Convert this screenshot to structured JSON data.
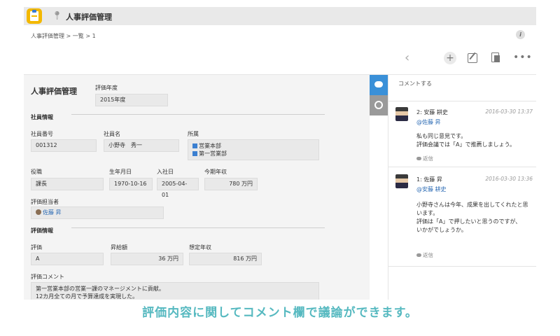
{
  "app": {
    "title": "人事評価管理"
  },
  "breadcrumb": "人事評価管理 > 一覧 > 1",
  "record": {
    "title": "人事評価管理",
    "fiscal_year": {
      "label": "評価年度",
      "value": "2015年度"
    },
    "employee_section": "社員情報",
    "employee_no": {
      "label": "社員番号",
      "value": "001312"
    },
    "employee_name": {
      "label": "社員名",
      "value": "小野寺　秀一"
    },
    "department": {
      "label": "所属",
      "values": [
        "営業本部",
        "第一営業部"
      ]
    },
    "position": {
      "label": "役職",
      "value": "課長"
    },
    "birth_date": {
      "label": "生年月日",
      "value": "1970-10-16"
    },
    "hire_date": {
      "label": "入社日",
      "value": "2005-04-01"
    },
    "current_salary": {
      "label": "今期年収",
      "value": "780 万円"
    },
    "evaluator": {
      "label": "評価担当者",
      "value": "佐藤 昇"
    },
    "eval_section": "評価情報",
    "rating": {
      "label": "評価",
      "value": "A"
    },
    "raise": {
      "label": "昇給額",
      "value": "36 万円"
    },
    "expected_salary": {
      "label": "想定年収",
      "value": "816 万円"
    },
    "comment": {
      "label": "評価コメント",
      "lines": [
        "第一営業本部の営業一課のマネージメントに貢献。",
        "12カ月全ての月で予算達成を実現した。"
      ]
    }
  },
  "panel": {
    "comment_placeholder": "コメントする",
    "comments": [
      {
        "author": "2: 安藤 耕史",
        "time": "2016-03-30 13:37",
        "mention": "@佐藤 昇",
        "lines": [
          "私も同じ意見です。",
          "評価会議では「A」で推薦しましょう。"
        ],
        "reply": "返信"
      },
      {
        "author": "1: 佐藤 昇",
        "time": "2016-03-30 13:36",
        "mention": "@安藤 耕史",
        "lines": [
          "小野寺さんは今年、成果を出してくれたと思",
          "います。",
          "評価は「A」で押したいと思うのですが、",
          "いかがでしょうか。"
        ],
        "reply": "返信"
      }
    ]
  },
  "caption": "評価内容に関してコメント欄で議論ができます。",
  "colors": {
    "accent": "#3a90d8",
    "caption": "#56b9c0",
    "app_icon": "#f3b800"
  },
  "icons": [
    "app-icon",
    "pin-icon",
    "info-icon",
    "back-icon",
    "add-icon",
    "edit-icon",
    "copy-icon",
    "more-icon",
    "comment-bubble-icon",
    "history-icon",
    "org-icon",
    "user-icon",
    "reply-icon"
  ]
}
